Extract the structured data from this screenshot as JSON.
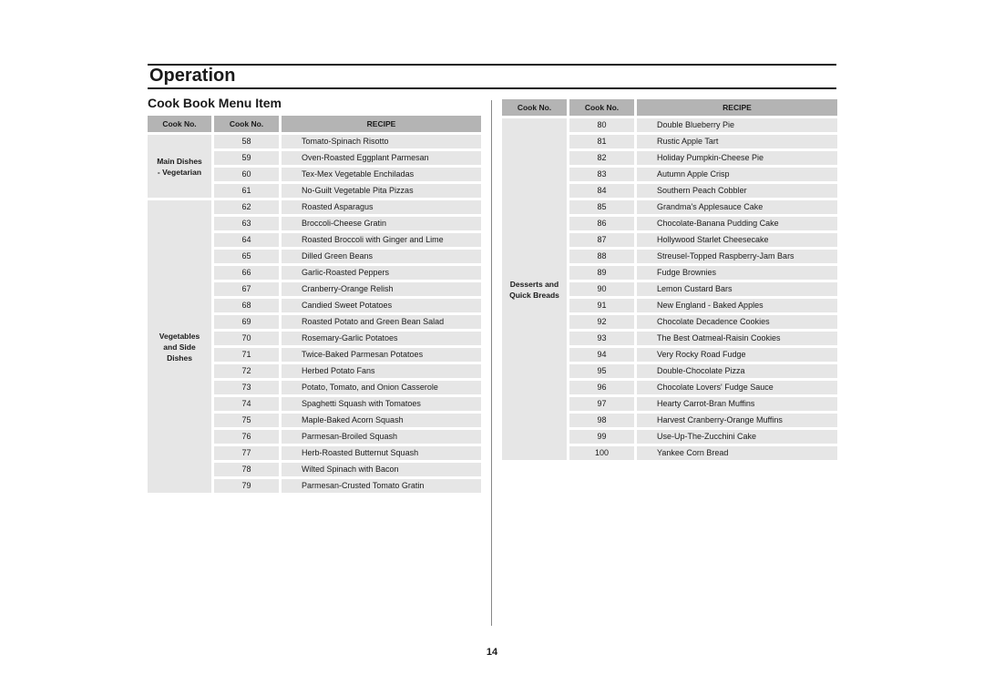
{
  "page": {
    "section_title": "Operation",
    "sub_title": "Cook Book Menu Item",
    "page_number": "14"
  },
  "left_table": {
    "headers": [
      "Cook No.",
      "Cook No.",
      "RECIPE"
    ],
    "groups": [
      {
        "category": "Main Dishes\n- Vegetarian",
        "rows": [
          {
            "no": "58",
            "recipe": "Tomato-Spinach Risotto"
          },
          {
            "no": "59",
            "recipe": "Oven-Roasted Eggplant Parmesan"
          },
          {
            "no": "60",
            "recipe": "Tex-Mex Vegetable Enchiladas"
          },
          {
            "no": "61",
            "recipe": "No-Guilt Vegetable Pita Pizzas"
          }
        ]
      },
      {
        "category": "Vegetables\nand Side\nDishes",
        "rows": [
          {
            "no": "62",
            "recipe": "Roasted Asparagus"
          },
          {
            "no": "63",
            "recipe": "Broccoli-Cheese Gratin"
          },
          {
            "no": "64",
            "recipe": "Roasted Broccoli with Ginger and Lime"
          },
          {
            "no": "65",
            "recipe": "Dilled Green Beans"
          },
          {
            "no": "66",
            "recipe": "Garlic-Roasted Peppers"
          },
          {
            "no": "67",
            "recipe": "Cranberry-Orange Relish"
          },
          {
            "no": "68",
            "recipe": "Candied Sweet Potatoes"
          },
          {
            "no": "69",
            "recipe": "Roasted Potato and Green Bean Salad"
          },
          {
            "no": "70",
            "recipe": "Rosemary-Garlic Potatoes"
          },
          {
            "no": "71",
            "recipe": "Twice-Baked Parmesan Potatoes"
          },
          {
            "no": "72",
            "recipe": "Herbed Potato Fans"
          },
          {
            "no": "73",
            "recipe": "Potato, Tomato, and Onion Casserole"
          },
          {
            "no": "74",
            "recipe": "Spaghetti Squash with Tomatoes"
          },
          {
            "no": "75",
            "recipe": "Maple-Baked Acorn Squash"
          },
          {
            "no": "76",
            "recipe": "Parmesan-Broiled Squash"
          },
          {
            "no": "77",
            "recipe": "Herb-Roasted Butternut Squash"
          },
          {
            "no": "78",
            "recipe": "Wilted Spinach with Bacon"
          },
          {
            "no": "79",
            "recipe": "Parmesan-Crusted Tomato Gratin"
          }
        ]
      }
    ]
  },
  "right_table": {
    "headers": [
      "Cook No.",
      "Cook No.",
      "RECIPE"
    ],
    "groups": [
      {
        "category": "Desserts and\nQuick Breads",
        "rows": [
          {
            "no": "80",
            "recipe": "Double Blueberry Pie"
          },
          {
            "no": "81",
            "recipe": "Rustic Apple Tart"
          },
          {
            "no": "82",
            "recipe": "Holiday Pumpkin-Cheese Pie"
          },
          {
            "no": "83",
            "recipe": "Autumn Apple Crisp"
          },
          {
            "no": "84",
            "recipe": "Southern Peach Cobbler"
          },
          {
            "no": "85",
            "recipe": "Grandma's Applesauce Cake"
          },
          {
            "no": "86",
            "recipe": "Chocolate-Banana Pudding Cake"
          },
          {
            "no": "87",
            "recipe": "Hollywood Starlet Cheesecake"
          },
          {
            "no": "88",
            "recipe": "Streusel-Topped Raspberry-Jam Bars"
          },
          {
            "no": "89",
            "recipe": "Fudge Brownies"
          },
          {
            "no": "90",
            "recipe": "Lemon Custard Bars"
          },
          {
            "no": "91",
            "recipe": "New England - Baked Apples"
          },
          {
            "no": "92",
            "recipe": "Chocolate Decadence Cookies"
          },
          {
            "no": "93",
            "recipe": "The Best Oatmeal-Raisin Cookies"
          },
          {
            "no": "94",
            "recipe": "Very Rocky Road Fudge"
          },
          {
            "no": "95",
            "recipe": "Double-Chocolate Pizza"
          },
          {
            "no": "96",
            "recipe": "Chocolate Lovers' Fudge Sauce"
          },
          {
            "no": "97",
            "recipe": "Hearty Carrot-Bran Muffins"
          },
          {
            "no": "98",
            "recipe": "Harvest Cranberry-Orange Muffins"
          },
          {
            "no": "99",
            "recipe": "Use-Up-The-Zucchini Cake"
          },
          {
            "no": "100",
            "recipe": "Yankee Corn Bread"
          }
        ]
      }
    ]
  }
}
